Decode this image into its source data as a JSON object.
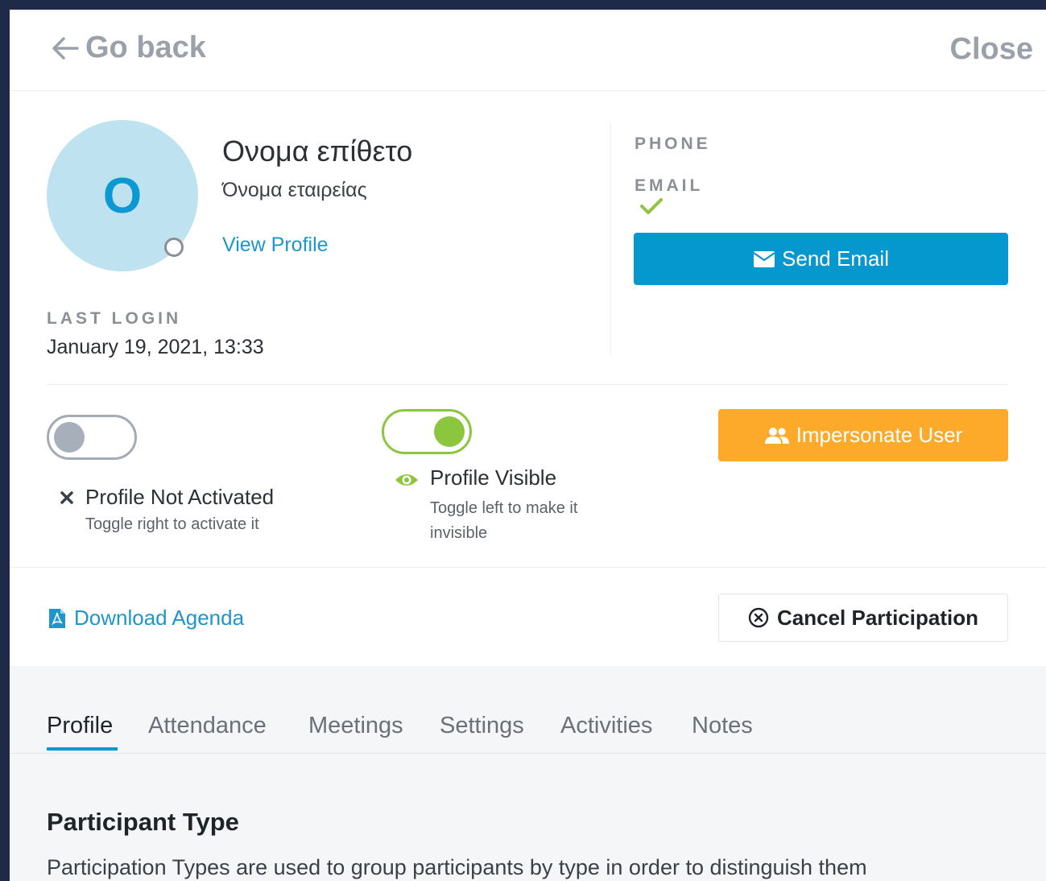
{
  "header": {
    "go_back_label": "Go back",
    "close_label": "Close"
  },
  "profile": {
    "avatar_initial": "O",
    "name": "Ονομα επίθετο",
    "company": "Όνομα εταιρείας",
    "view_profile_label": "View Profile",
    "last_login_label": "LAST LOGIN",
    "last_login_value": "January 19, 2021, 13:33"
  },
  "contact": {
    "phone_label": "PHONE",
    "email_label": "EMAIL",
    "send_email_label": "Send Email"
  },
  "activation": {
    "status_label": "Profile Not Activated",
    "hint": "Toggle right to activate it",
    "enabled": false
  },
  "visibility": {
    "status_label": "Profile Visible",
    "hint": "Toggle left to make it invisible",
    "enabled": true
  },
  "actions": {
    "impersonate_label": "Impersonate User",
    "download_agenda_label": "Download Agenda",
    "cancel_participation_label": "Cancel Participation"
  },
  "tabs": [
    {
      "label": "Profile",
      "active": true
    },
    {
      "label": "Attendance"
    },
    {
      "label": "Meetings"
    },
    {
      "label": "Settings"
    },
    {
      "label": "Activities"
    },
    {
      "label": "Notes"
    }
  ],
  "section": {
    "title": "Participant Type",
    "description": "Participation Types are used to group participants by type in order to distinguish them"
  },
  "colors": {
    "primary": "#0598cf",
    "success": "#8cc63f",
    "warning": "#fdaa2a",
    "avatar_bg": "#bfe2f1",
    "frame": "#1f2a48"
  },
  "icons": {
    "back": "arrow-left-icon",
    "email": "envelope-icon",
    "check": "check-icon",
    "not_activated": "x-icon",
    "visible": "eye-icon",
    "impersonate": "users-icon",
    "agenda": "pdf-file-icon",
    "cancel": "circle-x-icon"
  }
}
